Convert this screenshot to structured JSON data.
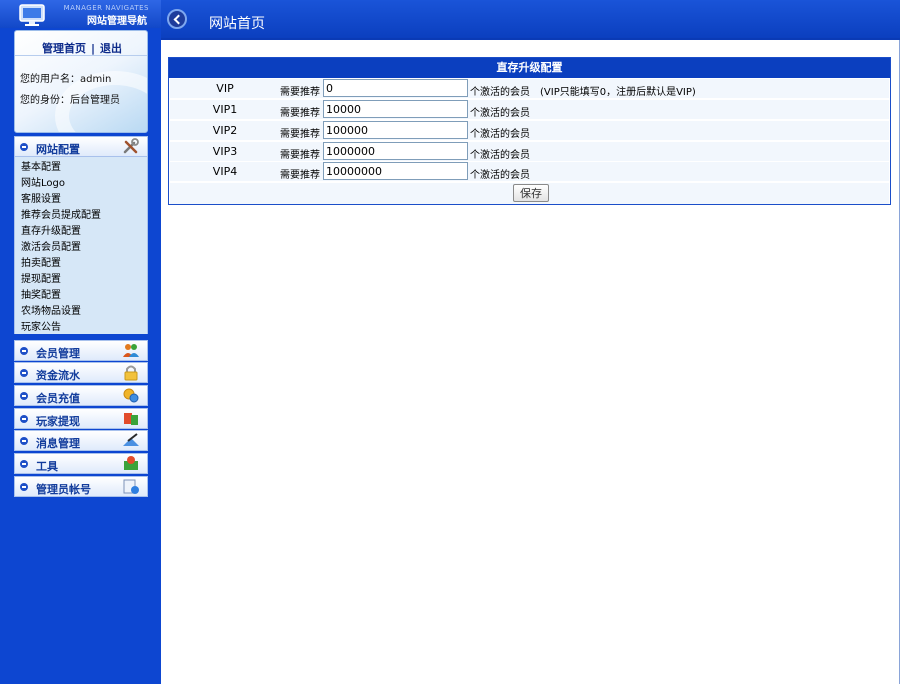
{
  "brand": {
    "subtitle": "MANAGER NAVIGATES",
    "title": "网站管理导航"
  },
  "user_panel": {
    "home_link": "管理首页",
    "separator": "|",
    "logout_link": "退出",
    "username_line": "您的用户名：admin",
    "role_line": "您的身份：后台管理员"
  },
  "sidebar": {
    "active_section": {
      "label": "网站配置",
      "icon": "tools-icon",
      "items": [
        "基本配置",
        "网站Logo",
        "客服设置",
        "推荐会员提成配置",
        "直存升级配置",
        "激活会员配置",
        "拍卖配置",
        "提现配置",
        "抽奖配置",
        "农场物品设置",
        "玩家公告"
      ]
    },
    "sections": [
      {
        "label": "会员管理",
        "icon": "users-icon"
      },
      {
        "label": "资金流水",
        "icon": "lock-icon"
      },
      {
        "label": "会员充值",
        "icon": "recharge-icon"
      },
      {
        "label": "玩家提现",
        "icon": "transfer-icon"
      },
      {
        "label": "消息管理",
        "icon": "message-icon"
      },
      {
        "label": "工具",
        "icon": "toolbox-icon"
      },
      {
        "label": "管理员帐号",
        "icon": "admin-account-icon"
      }
    ]
  },
  "topbar": {
    "title": "网站首页"
  },
  "config_panel": {
    "heading": "直存升级配置",
    "need_label": "需要推荐",
    "rows": [
      {
        "level": "VIP",
        "value": "0",
        "unit": "个激活的会员　(VIP只能填写0，注册后默认是VIP)"
      },
      {
        "level": "VIP1",
        "value": "10000",
        "unit": "个激活的会员"
      },
      {
        "level": "VIP2",
        "value": "100000",
        "unit": "个激活的会员"
      },
      {
        "level": "VIP3",
        "value": "1000000",
        "unit": "个激活的会员"
      },
      {
        "level": "VIP4",
        "value": "10000000",
        "unit": "个激活的会员"
      }
    ],
    "save_label": "保存"
  },
  "colors": {
    "sidebar_bg": "#0d46d1",
    "header_bg": "#0b3fbf",
    "row_bg": "#f2f7fd",
    "submenu_bg": "#d6e7f7"
  }
}
